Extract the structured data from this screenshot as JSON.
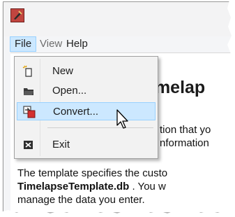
{
  "menubar": {
    "file_label": "File",
    "view_label": "View",
    "help_label": "Help"
  },
  "file_menu": {
    "items": [
      {
        "label": "New",
        "icon": "new-file-icon"
      },
      {
        "label": "Open...",
        "icon": "open-folder-icon"
      },
      {
        "label": "Convert...",
        "icon": "convert-icon"
      },
      {
        "label": "Exit",
        "icon": "exit-icon"
      }
    ],
    "highlighted_item": "Convert..."
  },
  "document": {
    "heading": "imelap",
    "line1": "tion that yo",
    "line2": "nformation",
    "line3": "The template specifies the custo",
    "line4_bold": "TimelapseTemplate.db",
    "line4_rest": " . You w",
    "line5": "manage the data you enter."
  },
  "colors": {
    "menu_highlight": "#cce8ff",
    "menu_highlight_border": "#99d1ff",
    "app_icon": "#c1453f"
  }
}
